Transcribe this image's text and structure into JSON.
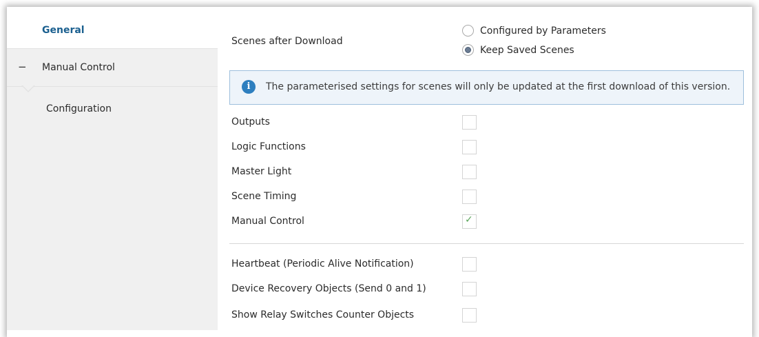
{
  "sidebar": {
    "items": [
      {
        "label": "General",
        "active": true
      },
      {
        "label": "Manual Control",
        "expand_symbol": "−"
      },
      {
        "label": "Configuration"
      }
    ]
  },
  "scenes": {
    "label": "Scenes after Download",
    "options": [
      "Configured by Parameters",
      "Keep Saved Scenes"
    ],
    "selected": "Keep Saved Scenes"
  },
  "info": {
    "icon": "info-icon",
    "icon_glyph": "i",
    "text": "The parameterised settings for scenes will only be updated at the first download of this version."
  },
  "checks_group1": [
    {
      "label": "Outputs",
      "checked": false
    },
    {
      "label": "Logic Functions",
      "checked": false
    },
    {
      "label": "Master Light",
      "checked": false
    },
    {
      "label": "Scene Timing",
      "checked": false
    },
    {
      "label": "Manual Control",
      "checked": true
    }
  ],
  "checks_group2": [
    {
      "label": "Heartbeat (Periodic Alive Notification)",
      "checked": false
    },
    {
      "label": "Device Recovery Objects (Send 0 and 1)",
      "checked": false
    },
    {
      "label": "Show Relay Switches Counter Objects",
      "checked": false
    }
  ],
  "check_glyph": "✓",
  "colors": {
    "accent": "#1a5f8f",
    "info_border": "#9dbfdc",
    "info_bg": "#eef4fa",
    "check": "#5aa55a"
  }
}
